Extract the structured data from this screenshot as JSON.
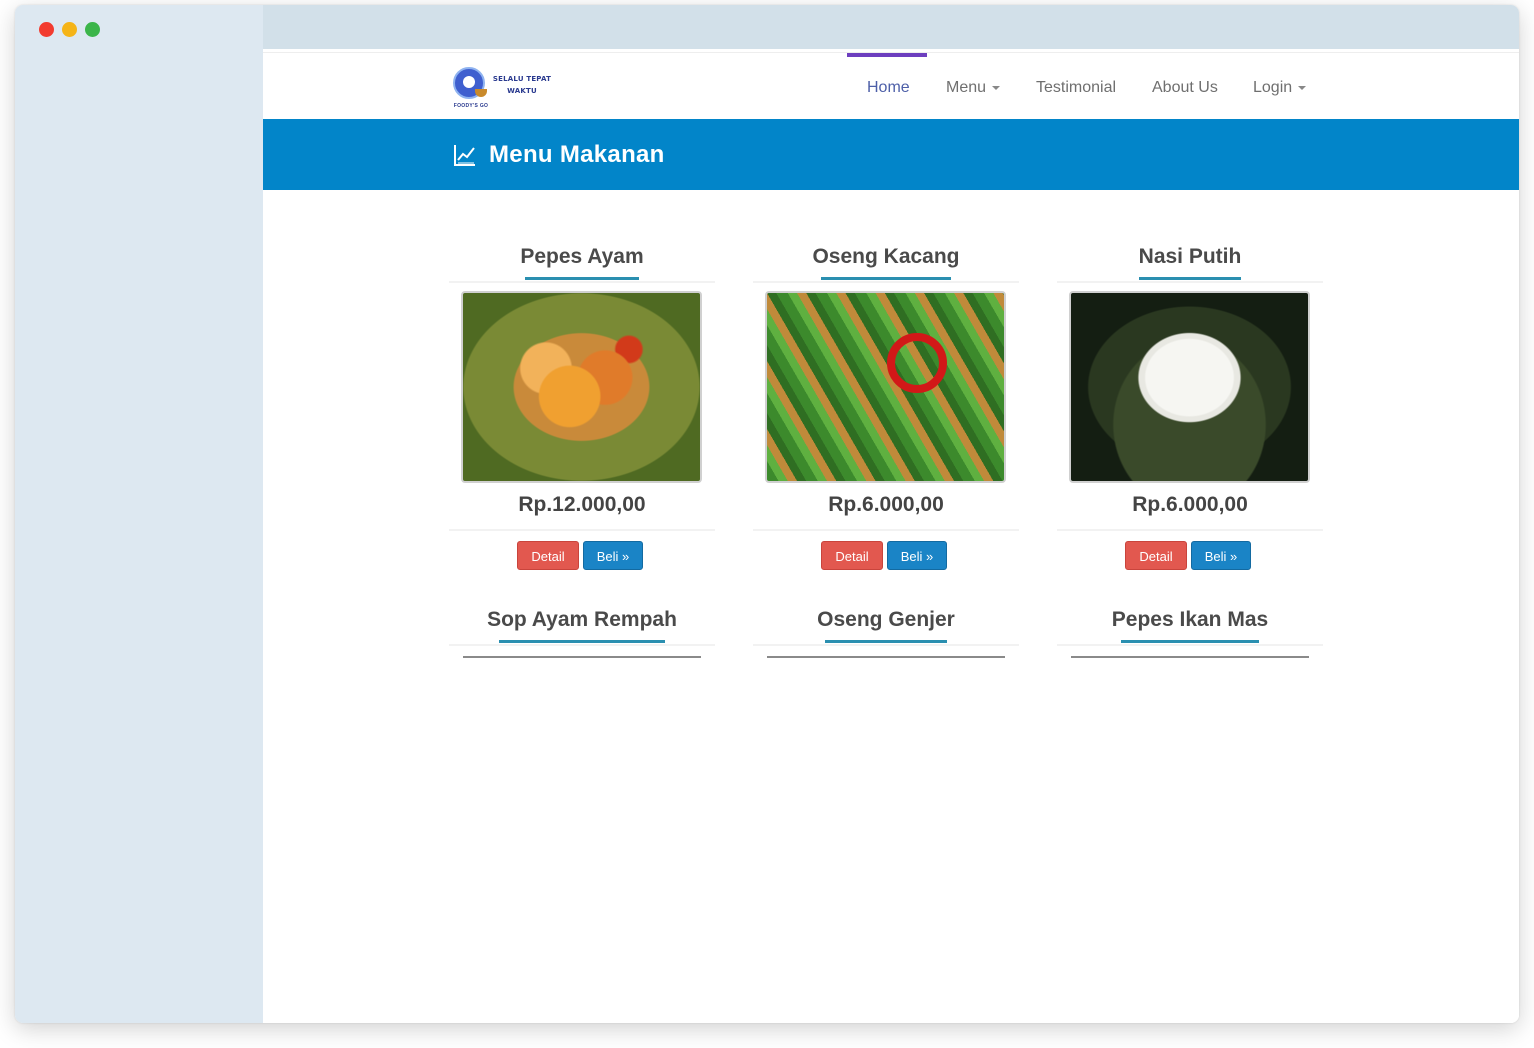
{
  "logo": {
    "line1": "SELALU TEPAT",
    "line2": "WAKTU",
    "sub": "FOODY'S GO"
  },
  "nav": {
    "items": [
      {
        "label": "Home",
        "active": true,
        "dropdown": false
      },
      {
        "label": "Menu",
        "active": false,
        "dropdown": true
      },
      {
        "label": "Testimonial",
        "active": false,
        "dropdown": false
      },
      {
        "label": "About Us",
        "active": false,
        "dropdown": false
      },
      {
        "label": "Login",
        "active": false,
        "dropdown": true
      }
    ]
  },
  "banner": {
    "title": "Menu Makanan",
    "icon": "line-chart-icon"
  },
  "menu": {
    "detail_label": "Detail",
    "beli_label": "Beli »",
    "items": [
      {
        "name": "Pepes Ayam",
        "price": "Rp.12.000,00",
        "image": "pepes-ayam-photo"
      },
      {
        "name": "Oseng Kacang",
        "price": "Rp.6.000,00",
        "image": "oseng-kacang-photo"
      },
      {
        "name": "Nasi Putih",
        "price": "Rp.6.000,00",
        "image": "nasi-putih-photo"
      },
      {
        "name": "Sop Ayam Rempah"
      },
      {
        "name": "Oseng Genjer"
      },
      {
        "name": "Pepes Ikan Mas"
      }
    ]
  },
  "colors": {
    "banner": "#0285c9",
    "nav_active": "#6d3fbf",
    "detail_button": "#e2584f",
    "beli_button": "#1a84c6",
    "sidebar": "#dde8f1"
  }
}
